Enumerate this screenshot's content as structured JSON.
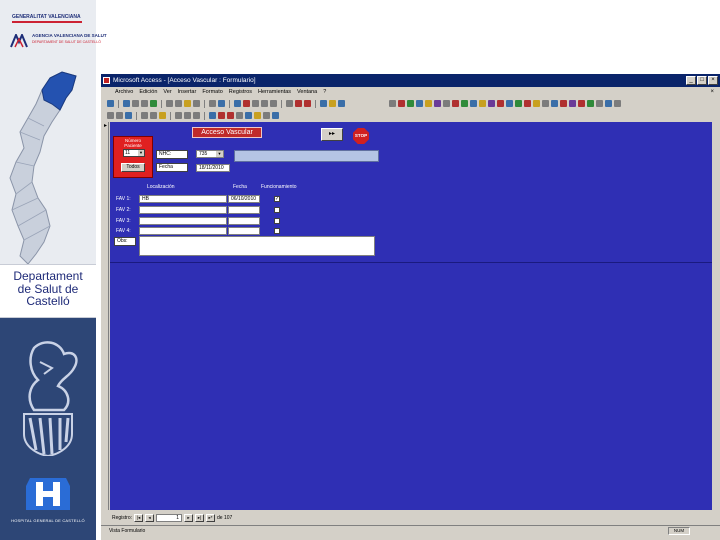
{
  "slide": {
    "logo": {
      "generalitat": "GENERALITAT VALENCIANA",
      "agency_name": "AGENCIA VALENCIANA DE SALUT",
      "agency_sub": "DEPARTAMENT DE SALUT DE CASTELLÓ"
    },
    "department_lines": [
      "Departament",
      "de Salut de",
      "Castelló"
    ],
    "hospital_name": "HOSPITAL GENERAL DE CASTELLÓ"
  },
  "window": {
    "title": "Microsoft Access - [Acceso Vascular : Formulario]",
    "menu": [
      "Archivo",
      "Edición",
      "Ver",
      "Insertar",
      "Formato",
      "Registros",
      "Herramientas",
      "Ventana",
      "?"
    ],
    "menu_close": "×",
    "controls": {
      "minimize": "_",
      "maximize": "□",
      "close": "×"
    }
  },
  "form": {
    "title": "Acceso Vascular",
    "next_button": "▸▸",
    "stop_button": "STOP",
    "red_panel": {
      "label": "Número Paciente",
      "selected": "11",
      "button": "Todos"
    },
    "fields": {
      "nhc_label": "NHC:",
      "nhc_value": "735",
      "fecha_label": "Fecha",
      "fecha_value": "18/11/2010"
    },
    "columns": {
      "localizacion": "Localización",
      "fecha": "Fecha",
      "funcionamiento": "Funcionamiento"
    },
    "rows": [
      {
        "label": "FAV 1:",
        "localizacion": "HB",
        "fecha": "06/10/2010",
        "checked": true
      },
      {
        "label": "FAV 2:",
        "localizacion": "",
        "fecha": "",
        "checked": false
      },
      {
        "label": "FAV 3:",
        "localizacion": "",
        "fecha": "",
        "checked": false
      },
      {
        "label": "FAV 4:",
        "localizacion": "",
        "fecha": "",
        "checked": false
      }
    ],
    "obs_label": "Obs:"
  },
  "record_nav": {
    "label": "Registro:",
    "current": "1",
    "of_label": "de 107"
  },
  "status": {
    "text": "Vista Formulario",
    "num": "NUM"
  }
}
